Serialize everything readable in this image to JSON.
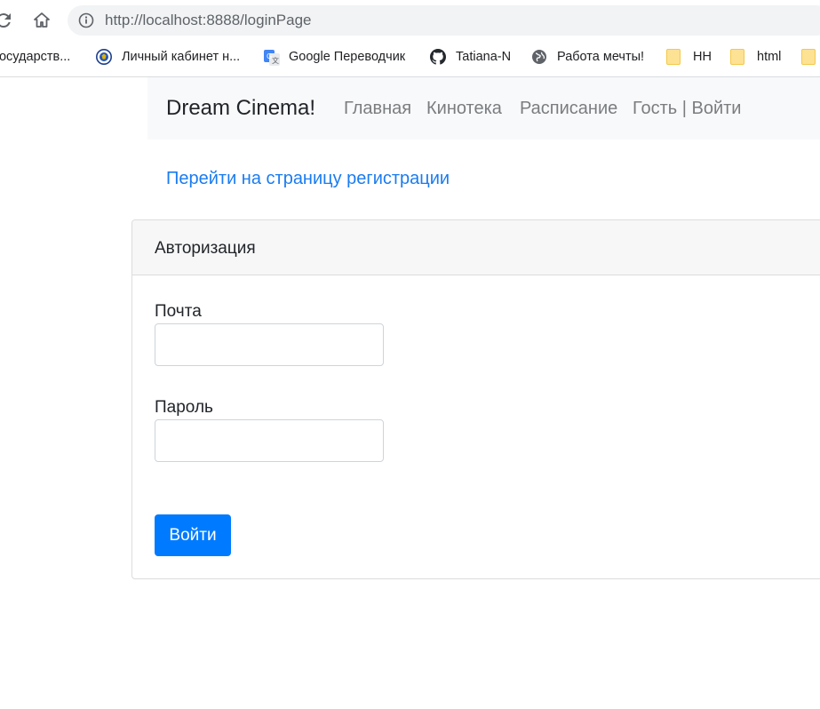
{
  "browser": {
    "url": "http://localhost:8888/loginPage",
    "bookmarks": [
      {
        "label": "государств...",
        "icon": "bookmark-site-icon"
      },
      {
        "label": "Личный кабинет н...",
        "icon": "tax-service-emblem-icon"
      },
      {
        "label": "Google Переводчик",
        "icon": "google-translate-icon"
      },
      {
        "label": "Tatiana-N",
        "icon": "github-icon"
      },
      {
        "label": "Работа мечты!",
        "icon": "globe-icon"
      },
      {
        "label": "HH",
        "icon": "folder-icon"
      },
      {
        "label": "html",
        "icon": "folder-icon"
      },
      {
        "label": "",
        "icon": "folder-icon"
      }
    ]
  },
  "navbar": {
    "brand": "Dream Cinema!",
    "links": [
      "Главная",
      "Кинотека",
      "Расписание",
      "Гость | Войти"
    ]
  },
  "register_link": "Перейти на страницу регистрации",
  "login_card": {
    "title": "Авторизация",
    "email_label": "Почта",
    "email_value": "",
    "password_label": "Пароль",
    "password_value": "",
    "submit_label": "Войти"
  },
  "colors": {
    "primary": "#007bff",
    "link": "#1a7cf0",
    "navbar_bg": "#f8f9fa",
    "card_header_bg": "#f7f7f7"
  }
}
